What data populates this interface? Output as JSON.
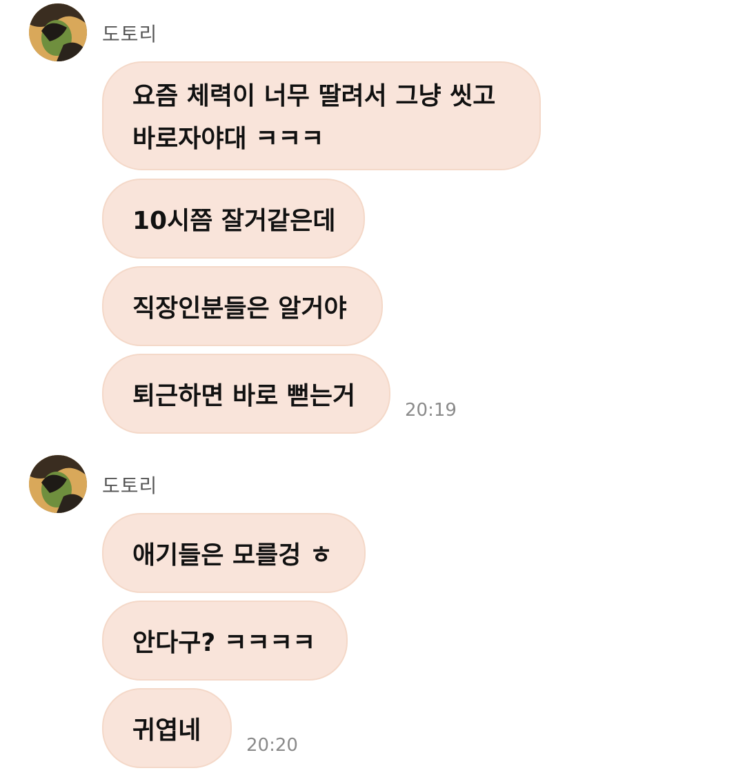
{
  "groups": [
    {
      "sender": "도토리",
      "messages": [
        "요즘 체력이 너무 딸려서 그냥 씻고",
        "바로자야대 ㅋㅋㅋ",
        "10시쯤 잘거같은데",
        "직장인분들은 알거야",
        "퇴근하면 바로 뻗는거"
      ],
      "time": "20:19"
    },
    {
      "sender": "도토리",
      "messages": [
        "애기들은 모를겅 ㅎ",
        "안다구? ㅋㅋㅋㅋ",
        "귀엽네"
      ],
      "time": "20:20"
    }
  ],
  "colors": {
    "bubble_bg": "#f9e4da",
    "bubble_border": "#f4d8c8",
    "time_text": "#8a8a8a",
    "sender_text": "#555555"
  },
  "icons": {
    "avatar": "profile-photo"
  }
}
